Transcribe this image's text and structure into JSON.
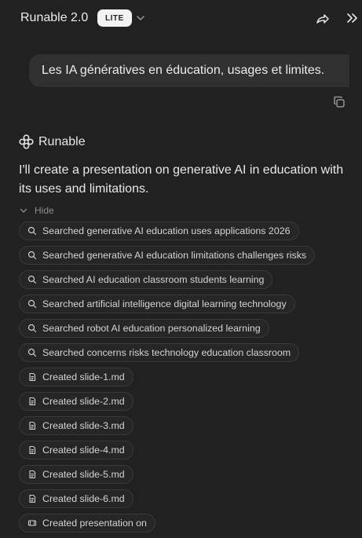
{
  "header": {
    "title": "Runable 2.0",
    "badge": "LITE",
    "icons": [
      "chevron-down-icon",
      "share-icon",
      "collapse-icon"
    ]
  },
  "user_message": {
    "text": "Les IA génératives en éducation, usages et limites."
  },
  "agent": {
    "name": "Runable",
    "reply": "I'll create a presentation on generative AI in education with its uses and limitations.",
    "hide_label": "Hide"
  },
  "steps": [
    {
      "icon": "search-icon",
      "label": "Searched generative AI education uses applications 2026"
    },
    {
      "icon": "search-icon",
      "label": "Searched generative AI education limitations challenges risks"
    },
    {
      "icon": "search-icon",
      "label": "Searched AI education classroom students learning"
    },
    {
      "icon": "search-icon",
      "label": "Searched artificial intelligence digital learning technology"
    },
    {
      "icon": "search-icon",
      "label": "Searched robot AI education personalized learning"
    },
    {
      "icon": "search-icon",
      "label": "Searched concerns risks technology education classroom"
    },
    {
      "icon": "file-icon",
      "label": "Created slide-1.md"
    },
    {
      "icon": "file-icon",
      "label": "Created slide-2.md"
    },
    {
      "icon": "file-icon",
      "label": "Created slide-3.md"
    },
    {
      "icon": "file-icon",
      "label": "Created slide-4.md"
    },
    {
      "icon": "file-icon",
      "label": "Created slide-5.md"
    },
    {
      "icon": "file-icon",
      "label": "Created slide-6.md"
    },
    {
      "icon": "presentation-icon",
      "label": "Created presentation on"
    }
  ],
  "colors": {
    "background": "#212121",
    "user_bubble": "#303030",
    "chip_border": "#3a3a3a",
    "badge_bg": "#f2f2f2"
  }
}
